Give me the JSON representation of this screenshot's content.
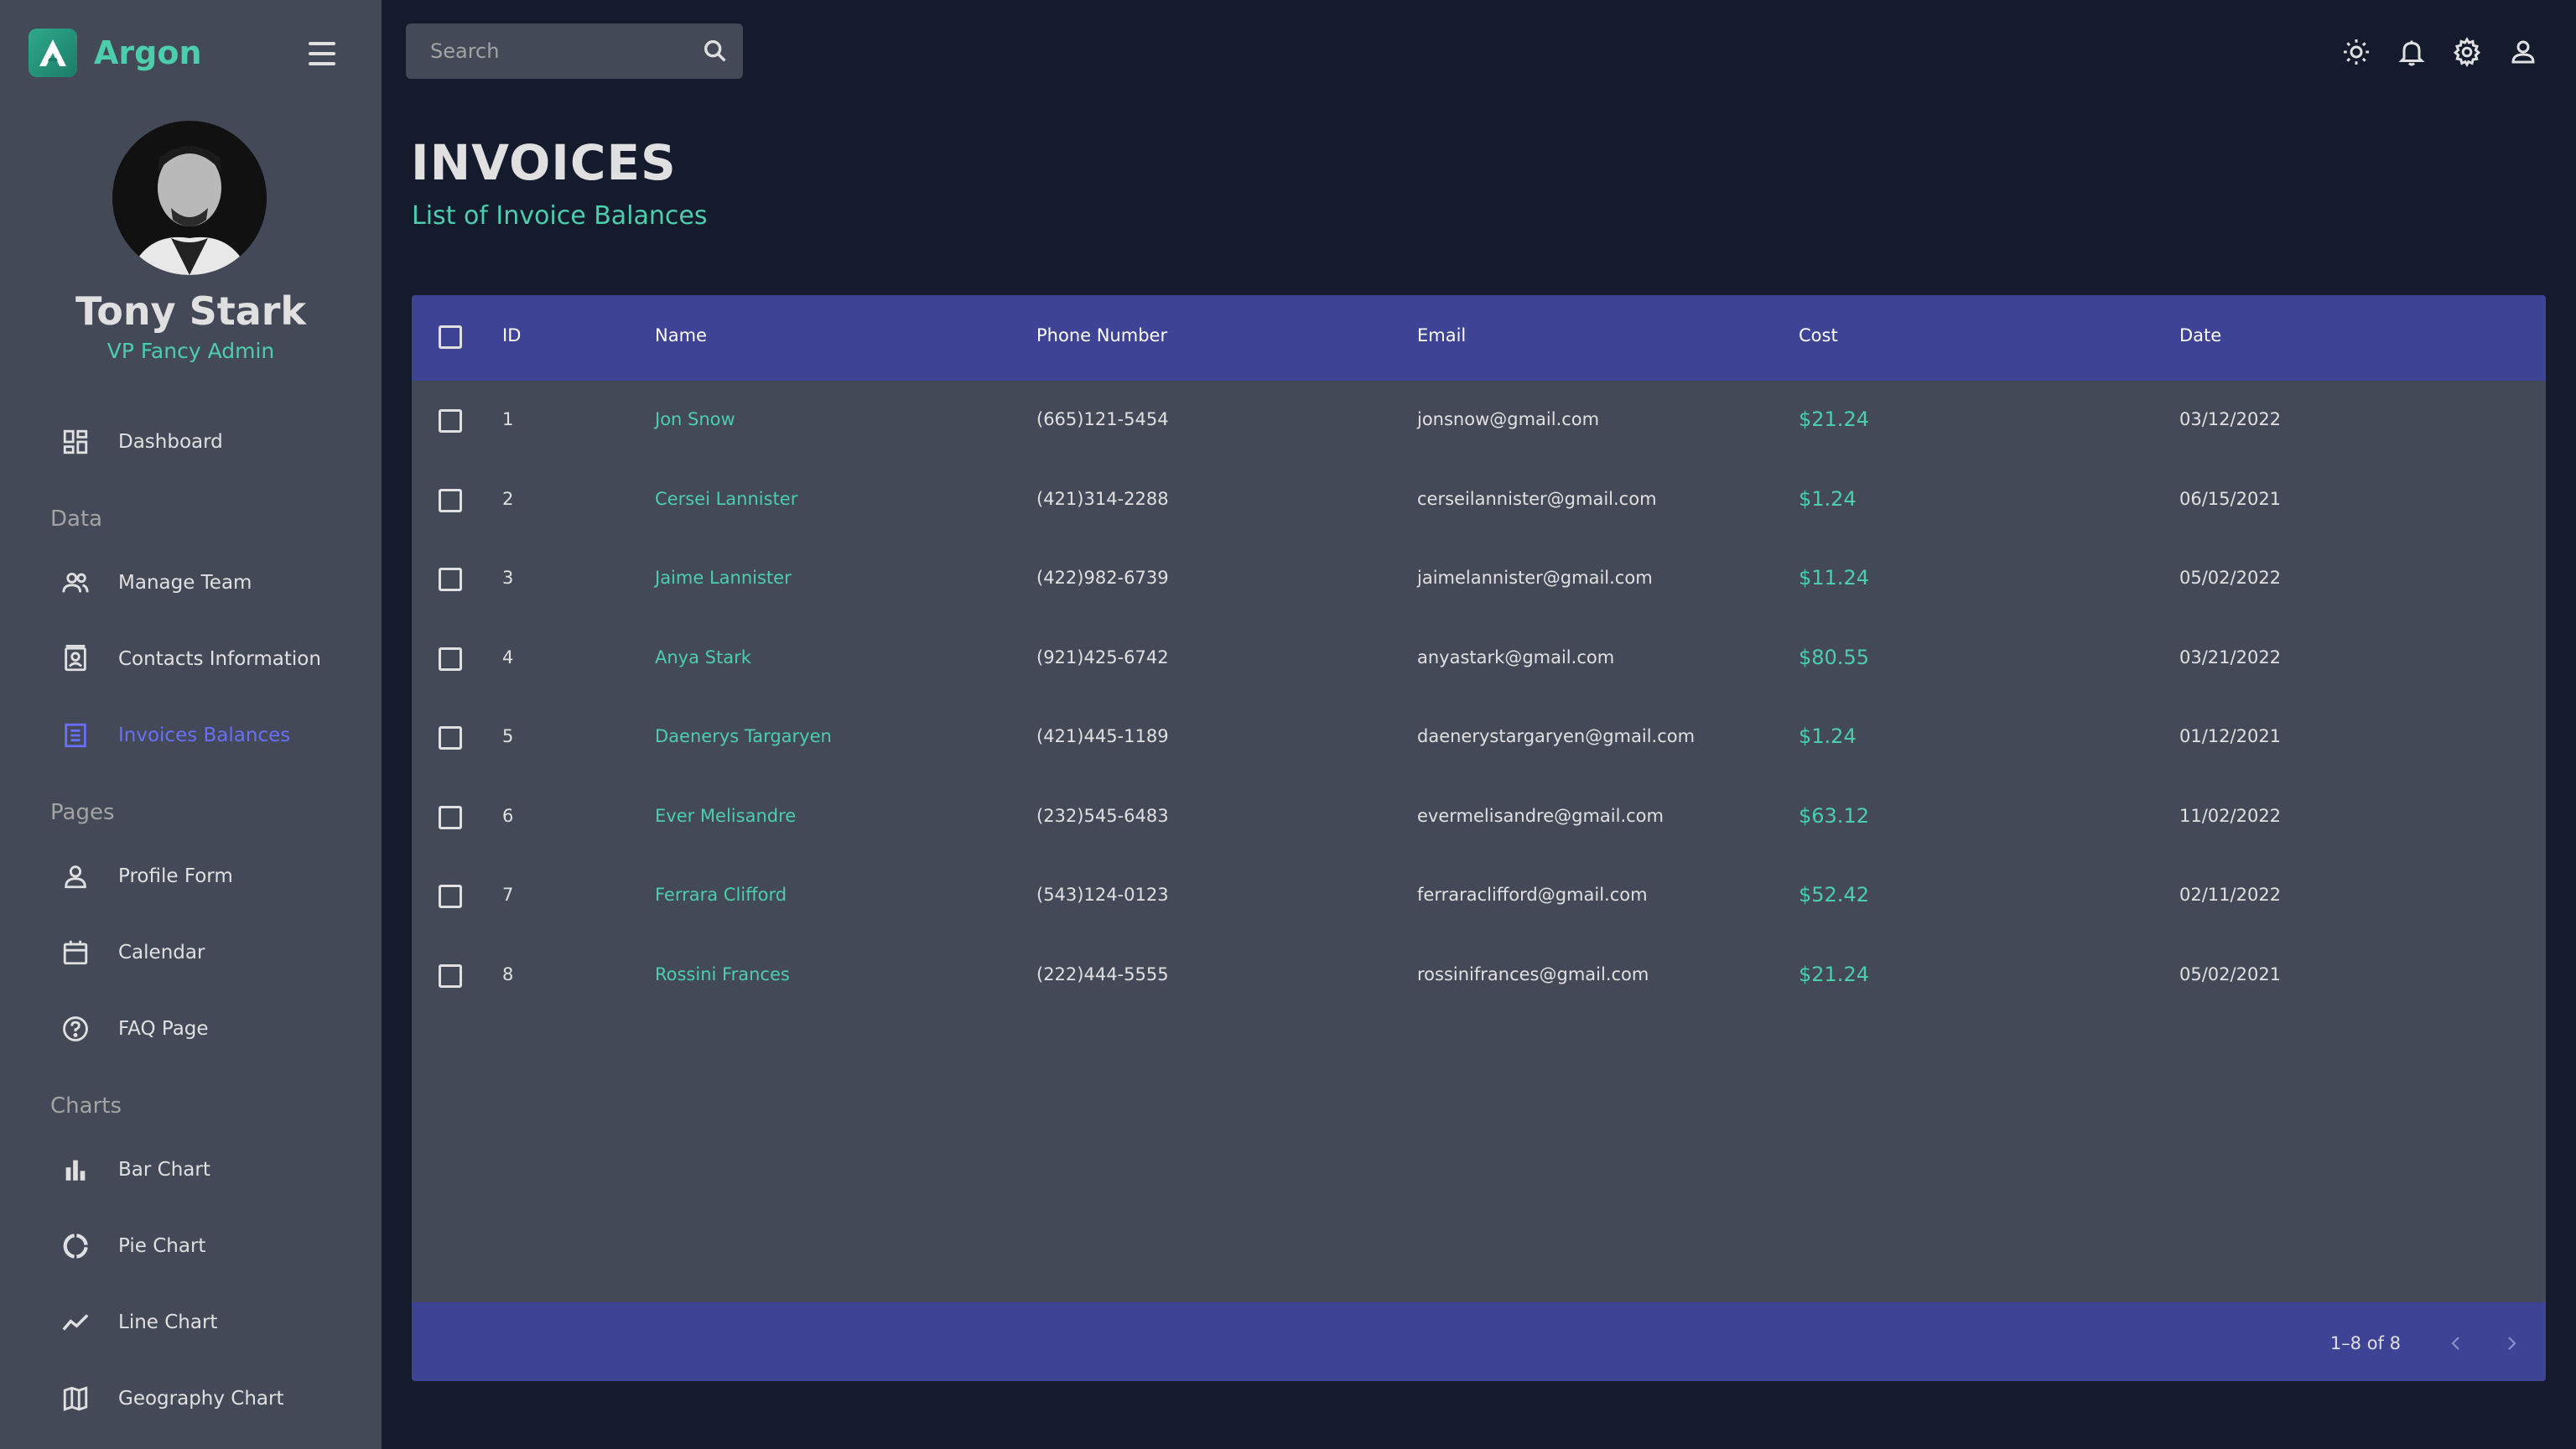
{
  "brand": {
    "name": "Argon"
  },
  "profile": {
    "name": "Tony Stark",
    "role": "VP Fancy Admin"
  },
  "sidebar": {
    "dashboard": "Dashboard",
    "section_data": "Data",
    "manage_team": "Manage Team",
    "contacts": "Contacts Information",
    "invoices": "Invoices Balances",
    "section_pages": "Pages",
    "profile_form": "Profile Form",
    "calendar": "Calendar",
    "faq": "FAQ Page",
    "section_charts": "Charts",
    "bar_chart": "Bar Chart",
    "pie_chart": "Pie Chart",
    "line_chart": "Line Chart",
    "geo_chart": "Geography Chart"
  },
  "search": {
    "placeholder": "Search"
  },
  "header": {
    "title": "INVOICES",
    "subtitle": "List of Invoice Balances"
  },
  "table": {
    "columns": {
      "id": "ID",
      "name": "Name",
      "phone": "Phone Number",
      "email": "Email",
      "cost": "Cost",
      "date": "Date"
    },
    "rows": [
      {
        "id": "1",
        "name": "Jon Snow",
        "phone": "(665)121-5454",
        "email": "jonsnow@gmail.com",
        "cost": "$21.24",
        "date": "03/12/2022"
      },
      {
        "id": "2",
        "name": "Cersei Lannister",
        "phone": "(421)314-2288",
        "email": "cerseilannister@gmail.com",
        "cost": "$1.24",
        "date": "06/15/2021"
      },
      {
        "id": "3",
        "name": "Jaime Lannister",
        "phone": "(422)982-6739",
        "email": "jaimelannister@gmail.com",
        "cost": "$11.24",
        "date": "05/02/2022"
      },
      {
        "id": "4",
        "name": "Anya Stark",
        "phone": "(921)425-6742",
        "email": "anyastark@gmail.com",
        "cost": "$80.55",
        "date": "03/21/2022"
      },
      {
        "id": "5",
        "name": "Daenerys Targaryen",
        "phone": "(421)445-1189",
        "email": "daenerystargaryen@gmail.com",
        "cost": "$1.24",
        "date": "01/12/2021"
      },
      {
        "id": "6",
        "name": "Ever Melisandre",
        "phone": "(232)545-6483",
        "email": "evermelisandre@gmail.com",
        "cost": "$63.12",
        "date": "11/02/2022"
      },
      {
        "id": "7",
        "name": "Ferrara Clifford",
        "phone": "(543)124-0123",
        "email": "ferraraclifford@gmail.com",
        "cost": "$52.42",
        "date": "02/11/2022"
      },
      {
        "id": "8",
        "name": "Rossini Frances",
        "phone": "(222)444-5555",
        "email": "rossinifrances@gmail.com",
        "cost": "$21.24",
        "date": "05/02/2021"
      }
    ],
    "pagination": "1–8 of 8"
  },
  "colors": {
    "accent": "#4cceac",
    "header_bg": "#3e4396",
    "active": "#6870fa",
    "panel": "#434957",
    "bg": "#141b2d"
  }
}
